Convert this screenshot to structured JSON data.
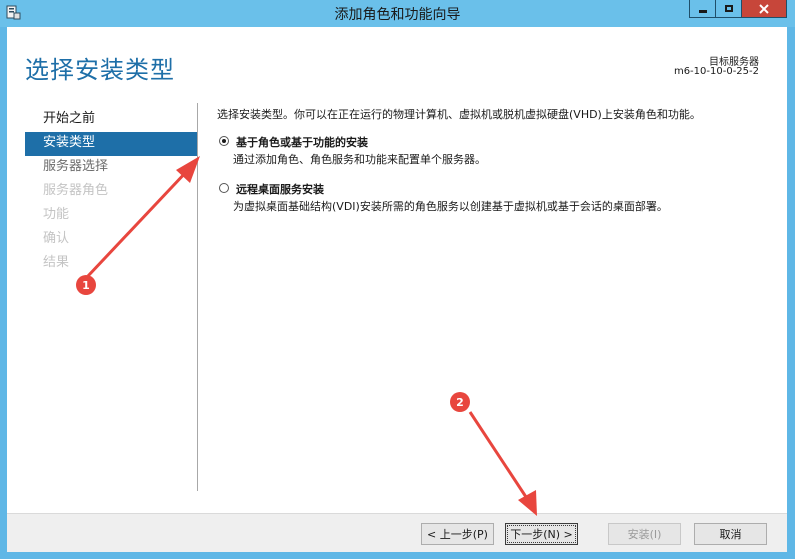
{
  "window": {
    "title": "添加角色和功能向导",
    "icon": "server-manager-icon",
    "controls": [
      "minimize-icon",
      "maximize-icon",
      "close-icon"
    ]
  },
  "header": {
    "title": "选择安装类型",
    "target_label": "目标服务器",
    "target_server": "m6-10-10-0-25-2"
  },
  "sidebar": {
    "items": [
      {
        "label": "开始之前",
        "state": "normal"
      },
      {
        "label": "安装类型",
        "state": "active"
      },
      {
        "label": "服务器选择",
        "state": "normal"
      },
      {
        "label": "服务器角色",
        "state": "disabled"
      },
      {
        "label": "功能",
        "state": "disabled"
      },
      {
        "label": "确认",
        "state": "disabled"
      },
      {
        "label": "结果",
        "state": "disabled"
      }
    ]
  },
  "main": {
    "intro": "选择安装类型。你可以在正在运行的物理计算机、虚拟机或脱机虚拟硬盘(VHD)上安装角色和功能。",
    "options": [
      {
        "title": "基于角色或基于功能的安装",
        "description": "通过添加角色、角色服务和功能来配置单个服务器。",
        "selected": true
      },
      {
        "title": "远程桌面服务安装",
        "description": "为虚拟桌面基础结构(VDI)安装所需的角色服务以创建基于虚拟机或基于会话的桌面部署。",
        "selected": false
      }
    ]
  },
  "footer": {
    "prev_label": "< 上一步(P)",
    "next_label": "下一步(N) >",
    "install_label": "安装(I)",
    "cancel_label": "取消"
  },
  "annotations": {
    "badge1": "1",
    "badge2": "2",
    "color": "#e8463e"
  },
  "colors": {
    "accent": "#1e6fa8",
    "titlebar": "#6ac0ea",
    "close": "#c7463a"
  }
}
